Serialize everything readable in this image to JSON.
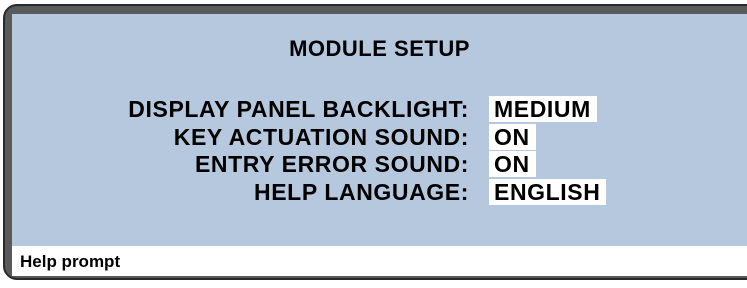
{
  "screen": {
    "title": "MODULE SETUP",
    "settings": [
      {
        "label": "DISPLAY PANEL BACKLIGHT:",
        "value": "MEDIUM"
      },
      {
        "label": "KEY ACTUATION SOUND:",
        "value": "ON"
      },
      {
        "label": "ENTRY ERROR SOUND:",
        "value": "ON"
      },
      {
        "label": "HELP LANGUAGE:",
        "value": "ENGLISH"
      }
    ]
  },
  "prompt": {
    "text": "Help prompt"
  },
  "colors": {
    "screen_background": "#b5c8dd",
    "bezel": "#5a5a5a",
    "value_background": "#ffffff",
    "prompt_background": "#ffffff"
  }
}
